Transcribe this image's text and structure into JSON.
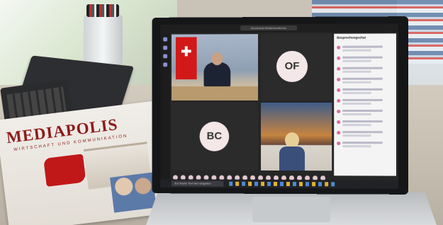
{
  "magazine": {
    "title": "MEDIAPOLIS",
    "subtitle": "WIRTSCHAFT UND KOMMUNIKATION"
  },
  "meeting": {
    "window_title": "Bundesrat Medienkonferenz",
    "chat_title": "Besprechungschat",
    "participants": {
      "of_initials": "OF",
      "bc_initials": "BC"
    }
  },
  "taskbar": {
    "search_placeholder": "Zur Suche Text hier eingeben"
  },
  "colors": {
    "swiss_red": "#d21818",
    "magazine_red": "#8e1b1b",
    "teams_accent": "#8a8fd1"
  }
}
